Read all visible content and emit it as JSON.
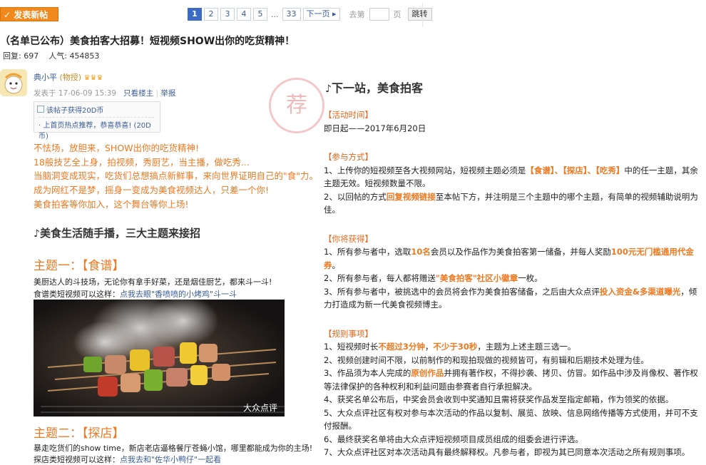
{
  "toolbar": {
    "post_button": "✓ 发表新帖",
    "pages": [
      "1",
      "2",
      "3",
      "4",
      "5"
    ],
    "ellipsis": "...",
    "last_page": "33",
    "next": "下一页 ▸",
    "goto_label": "去第",
    "goto_unit": "页",
    "goto_button": "跳转",
    "current_page": 1
  },
  "thread": {
    "title": "（名单已公布）美食拍客大招募！短视频SHOW出你的吃货精神！",
    "replies_label": "回复:",
    "replies": "697",
    "views_label": "人气:",
    "views": "454853"
  },
  "author": {
    "name": "典小平",
    "role": "(物授)",
    "badges": "♛♛♛",
    "posted": "发表于 17-06-09 15:39",
    "only_author": "只看楼主",
    "report": "举报",
    "tip1": "该帖子获得20D币",
    "tip2": "· 上首页热点推荐，恭喜恭喜! (20D币)",
    "stamp_char": "荐"
  },
  "left": {
    "lines": [
      "不怯场，放胆来，SHOW出你的吃货精神!",
      "18般技艺全上身，拍视频，秀厨艺，当主播，做吃秀...",
      "当脑洞变成现实，吃货们总想搞点新鲜事，来向世界证明自己的\"食\"力。",
      "成为网红不是梦，摇身一变成为美食视频达人，只差一个你!",
      "美食拍客等你加入，这个舞台等你上场!"
    ],
    "section_title": "美食生活随手播，三大主题来接招",
    "theme1": "主题一：【食谱】",
    "theme1_p1": "美厨达人的斗技场，无论你有拿手好菜，还是烟佳厨艺，都来斗一斗!",
    "theme1_p2_prefix": "食谱类短视频可以这样：",
    "theme1_p2_link": "点我去眼\"香喷喷的小烤鸡\"斗一斗",
    "photo_watermark": "大众点评",
    "theme2": "主题二：【探店】",
    "theme2_p1": "暴走吃货们的show time，新店老店逼格餐厅苍蝇小馆，哪里都能成为你的主场!",
    "theme2_p2_prefix": "探店类短视频可以这样：",
    "theme2_p2_link": "点我去和\"佐华小鸭仔\"一起看"
  },
  "right": {
    "title": "下一站，美食拍客",
    "time_head": "【活动时间】",
    "time_text": "即日起——2017年6月20日",
    "method_head": "【参与方式】",
    "method_1a": "1、上传你的短视频至各大视频网站，短视频主题必须是",
    "method_1b": "【食谱】、【探店】、【吃秀】",
    "method_1c": "中的任一主题，其余主题无效。短视频数量不限。",
    "method_2a": "2、以回帖的方式",
    "method_2b": "回复视频链接",
    "method_2c": "至本帖下方，并注明是三个主题中的哪个主题，有简单的视频辅助说明为佳。",
    "prize_head": "【你将获得】",
    "prize_1a": "1、所有参与者中，选取",
    "prize_1b": "10名",
    "prize_1c": "会员以及作品作为美食拍客第一储备，并每人奖励",
    "prize_1d": "100元无门槛通用代金券",
    "prize_1e": "。",
    "prize_2a": "2、所有参与者，每人都将赠送",
    "prize_2b": "\"美食拍客\"社区小徽章",
    "prize_2c": "一枚。",
    "prize_3a": "3、所有参与者中，被挑选中的会员将会作为美食拍客储备，之后由大众点评",
    "prize_3b": "投入资金&多渠道曝光",
    "prize_3c": "，倾力打造成为新一代美食视频博主。",
    "rules_head": "【规则事项】",
    "rule_1a": "1、短视频时长",
    "rule_1b": "不超过3分钟",
    "rule_1c": "，",
    "rule_1d": "不少于30秒",
    "rule_1e": "，主题为上述主题三选一。",
    "rule_2": "2、视频创建时间不限，以前制作的和现拍现做的视频皆可，有剪辑和后期技术处理为佳。",
    "rule_3a": "3、作品须为本人完成的",
    "rule_3b": "原创作品",
    "rule_3c": "并拥有著作权，不得抄袭、拷贝、仿冒。如作品中涉及肖像权、著作权等法律保护的各种权利和利益问题由参赛者自行承担解决。",
    "rule_4": "4、获奖名单公布后，中奖会员会收到中奖通知且需将获奖作品发至指定邮箱，作为领奖的依据。",
    "rule_5": "5、大众点评社区有权对参与本次活动的作品以复制、展览、放映、信息网络传播等方式使用，并可不支付报酬。",
    "rule_6": "6、最终获奖名单将由大众点评短视频项目成员组成的组委会进行评选。",
    "rule_7": "7、大众点评社区对本次活动具有最终解释权。凡参与者，即视为其已同意本次活动之所有规则事项。"
  },
  "colors": {
    "accent_orange": "#f07820",
    "link_blue": "#3a5c99",
    "page_active": "#3a6bc6"
  }
}
